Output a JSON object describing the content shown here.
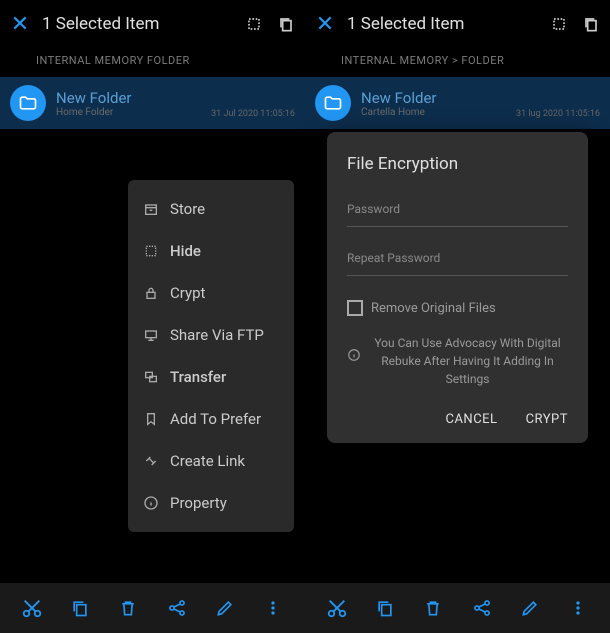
{
  "left": {
    "selection": {
      "title": "1 Selected Item"
    },
    "breadcrumb": "INTERNAL MEMORY FOLDER",
    "folder": {
      "name": "New Folder",
      "sub": "Home Folder",
      "date": "31 Jul 2020  11:05:16"
    },
    "menu": {
      "store": "Store",
      "hide": "Hide",
      "crypt": "Crypt",
      "share_ftp": "Share Via FTP",
      "transfer": "Transfer",
      "add_prefer": "Add To Prefer",
      "create_link": "Create Link",
      "property": "Property"
    }
  },
  "right": {
    "selection": {
      "title": "1 Selected Item"
    },
    "breadcrumb": "INTERNAL MEMORY > FOLDER",
    "folder": {
      "name": "New Folder",
      "sub": "Cartella Home",
      "date": "31 lug 2020  11:05:16"
    },
    "modal": {
      "title": "File Encryption",
      "password_placeholder": "Password",
      "repeat_placeholder": "Repeat Password",
      "checkbox_label": "Remove Original Files",
      "info_text": "You Can Use Advocacy With Digital Rebuke After Having It Adding In Settings",
      "cancel": "CANCEL",
      "crypt": "CRYPT"
    }
  },
  "colors": {
    "accent": "#2196f3",
    "row_bg": "#0d2d4c"
  }
}
